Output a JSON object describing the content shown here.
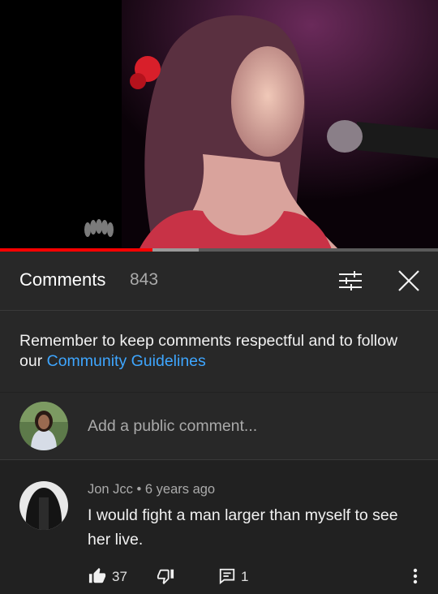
{
  "video": {
    "logo_icon": "nbc-peacock-icon",
    "progress_played": 0.35,
    "progress_buffered": 0.45
  },
  "comments_header": {
    "title": "Comments",
    "count": "843",
    "filter_icon": "sort-sliders-icon",
    "close_icon": "close-icon"
  },
  "notice": {
    "text": "Remember to keep comments respectful and to follow our ",
    "link": "Community Guidelines"
  },
  "add_comment": {
    "placeholder": "Add a public comment..."
  },
  "comment": {
    "author": "Jon Jcc",
    "time": "6 years ago",
    "text": "I would fight a man larger than myself to see her live.",
    "likes": "37",
    "replies": "1"
  },
  "colors": {
    "background": "#212121",
    "panel": "#282828",
    "link": "#3ea6ff",
    "progress": "#ff0000"
  }
}
